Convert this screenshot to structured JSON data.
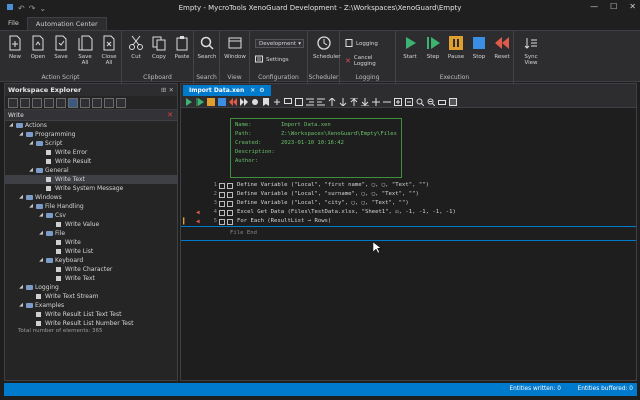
{
  "window": {
    "title": "Empty - MycroTools XenoGuard Development - Z:\\Workspaces\\XenoGuard\\Empty",
    "minimize": "—",
    "maximize": "☐",
    "close": "✕"
  },
  "menu_tabs": [
    {
      "label": "File"
    },
    {
      "label": "Automation Center"
    }
  ],
  "ribbon": {
    "groups": {
      "action_script": {
        "label": "Action Script",
        "buttons": [
          {
            "label": "New"
          },
          {
            "label": "Open"
          },
          {
            "label": "Save"
          },
          {
            "label": "Save All"
          },
          {
            "label": "Close All"
          }
        ]
      },
      "clipboard": {
        "label": "Clipboard",
        "buttons": [
          {
            "label": "Cut"
          },
          {
            "label": "Copy"
          },
          {
            "label": "Paste"
          }
        ]
      },
      "search": {
        "label": "Search",
        "button": "Search"
      },
      "view": {
        "label": "View",
        "button": "Window"
      },
      "configuration": {
        "label": "Configuration",
        "combo": "Development",
        "settings": "Settings"
      },
      "scheduler": {
        "label": "Scheduler",
        "button": "Scheduler"
      },
      "logging": {
        "label": "Logging",
        "logging": "Logging",
        "cancel_logging": "Cancel Logging"
      },
      "execution": {
        "label": "Execution",
        "buttons": [
          {
            "label": "Start"
          },
          {
            "label": "Step"
          },
          {
            "label": "Pause"
          },
          {
            "label": "Stop"
          },
          {
            "label": "Reset"
          }
        ]
      },
      "sync": {
        "button": "Sync View"
      }
    }
  },
  "explorer": {
    "title": "Workspace Explorer",
    "pin": "⊞",
    "close": "✕",
    "search_value": "Write",
    "tree": [
      {
        "depth": 0,
        "label": "Actions",
        "type": "folder",
        "expanded": true
      },
      {
        "depth": 1,
        "label": "Programming",
        "type": "folder",
        "expanded": true
      },
      {
        "depth": 2,
        "label": "Script",
        "type": "folder",
        "expanded": true
      },
      {
        "depth": 3,
        "label": "Write Error",
        "type": "doc"
      },
      {
        "depth": 3,
        "label": "Write Result",
        "type": "doc"
      },
      {
        "depth": 2,
        "label": "General",
        "type": "folder",
        "expanded": true
      },
      {
        "depth": 3,
        "label": "Write Text",
        "type": "doc",
        "selected": true
      },
      {
        "depth": 3,
        "label": "Write System Message",
        "type": "doc"
      },
      {
        "depth": 1,
        "label": "Windows",
        "type": "folder",
        "expanded": true
      },
      {
        "depth": 2,
        "label": "File Handling",
        "type": "folder",
        "expanded": true
      },
      {
        "depth": 3,
        "label": "Csv",
        "type": "folder",
        "expanded": true
      },
      {
        "depth": 4,
        "label": "Write Value",
        "type": "doc"
      },
      {
        "depth": 3,
        "label": "File",
        "type": "folder",
        "expanded": true
      },
      {
        "depth": 4,
        "label": "Write",
        "type": "doc"
      },
      {
        "depth": 4,
        "label": "Write List",
        "type": "doc"
      },
      {
        "depth": 3,
        "label": "Keyboard",
        "type": "folder",
        "expanded": true
      },
      {
        "depth": 4,
        "label": "Write Character",
        "type": "doc"
      },
      {
        "depth": 4,
        "label": "Write Text",
        "type": "doc"
      },
      {
        "depth": 1,
        "label": "Logging",
        "type": "folder",
        "expanded": true
      },
      {
        "depth": 2,
        "label": "Write Text Stream",
        "type": "doc"
      },
      {
        "depth": 1,
        "label": "Examples",
        "type": "folder",
        "expanded": true
      },
      {
        "depth": 2,
        "label": "Write Result List Text Test",
        "type": "doc"
      },
      {
        "depth": 2,
        "label": "Write Result List Number Test",
        "type": "doc"
      }
    ],
    "total": "Total number of elements: 365"
  },
  "editor": {
    "tab": "Import Data.xen",
    "info": [
      {
        "key": "Name:",
        "value": "Import Data.xen"
      },
      {
        "key": "Path:",
        "value": "Z:\\Workspaces\\XenoGuard\\Empty\\Files"
      },
      {
        "key": "Created:",
        "value": "2023-01-10 10:16:42"
      },
      {
        "key": "Description:",
        "value": ""
      },
      {
        "key": "Author:",
        "value": ""
      }
    ],
    "lines": [
      {
        "num": "1",
        "text": "Define Variable (\"Local\", \"first name\", ▢, ▢, \"Text\", \"\")"
      },
      {
        "num": "2",
        "text": "Define Variable (\"Local\", \"surname\", ▢, ▢, \"Text\", \"\")"
      },
      {
        "num": "3",
        "text": "Define Variable (\"Local\", \"city\", ▢, ▢, \"Text\", \"\")"
      },
      {
        "num": "4",
        "text": "Excel Get Data (Files\\TestData.xlsx, \"Sheet1\", ☑, -1, -1, -1, -1)"
      },
      {
        "num": "5",
        "text": "For Each (ResultList → Rows)"
      }
    ],
    "file_end": "File End"
  },
  "status": {
    "written": "Entities written: 0",
    "buffered": "Entities buffered: 0"
  },
  "colors": {
    "accent": "#007acc",
    "info_green": "#6abf6a",
    "run_green": "#3cb371",
    "pause_orange": "#e0a030",
    "stop_blue": "#3a8ee6",
    "reset_red": "#e05a4a"
  }
}
